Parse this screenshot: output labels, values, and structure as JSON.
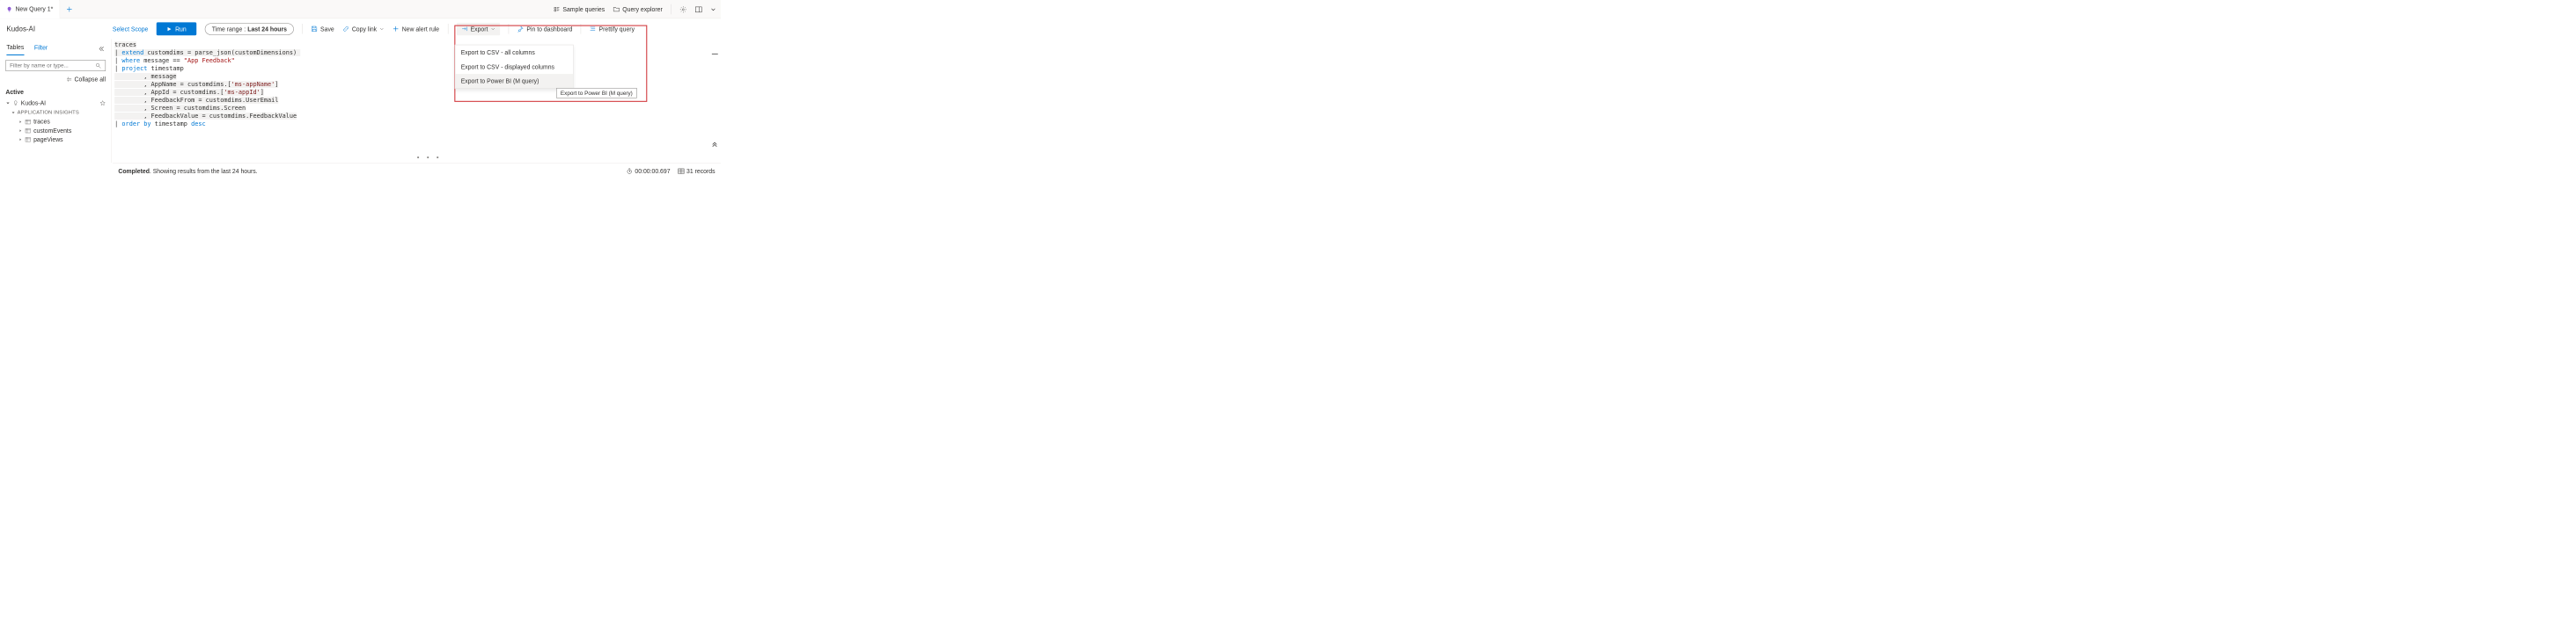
{
  "tabs": {
    "active": "New Query 1*"
  },
  "topRight": {
    "sample": "Sample queries",
    "explorer": "Query explorer"
  },
  "toolbar": {
    "scopeName": "Kudos-AI",
    "selectScope": "Select Scope",
    "run": "Run",
    "timeLabel": "Time range : ",
    "timeValue": "Last 24 hours",
    "save": "Save",
    "copy": "Copy link",
    "alert": "New alert rule",
    "export": "Export",
    "pin": "Pin to dashboard",
    "prettify": "Prettify query"
  },
  "exportMenu": {
    "csvAll": "Export to CSV - all columns",
    "csvDisp": "Export to CSV - displayed columns",
    "pbi": "Export to Power BI (M query)",
    "tooltip": "Export to Power BI (M query)"
  },
  "sidebar": {
    "tabTables": "Tables",
    "tabFilter": "Filter",
    "searchPlaceholder": "Filter by name or type...",
    "collapse": "Collapse all",
    "activeHdr": "Active",
    "root": "Kudos-AI",
    "group": "APPLICATION INSIGHTS",
    "leaves": [
      "traces",
      "customEvents",
      "pageViews"
    ]
  },
  "query": {
    "l1": "traces",
    "l2a": "| ",
    "l2b": "extend",
    "l2c": " customdims = parse_json(customDimensions)",
    "l3a": "| ",
    "l3b": "where",
    "l3c": " message == ",
    "l3d": "\"App Feedback\"",
    "l4a": "| ",
    "l4b": "project",
    "l4c": " timestamp",
    "l5": "        , message",
    "l6a": "        , AppName = customdims.[",
    "l6b": "'ms-appName'",
    "l6c": "]",
    "l7a": "        , AppId = customdims.[",
    "l7b": "'ms-appId'",
    "l7c": "]",
    "l8": "        , FeedbackFrom = customdims.UserEmail",
    "l9": "        , Screen = customdims.Screen",
    "l10": "        , FeedbackValue = customdims.FeedbackValue",
    "l11a": "| ",
    "l11b": "order by",
    "l11c": " timestamp ",
    "l11d": "desc"
  },
  "status": {
    "done": "Completed",
    "rest": ". Showing results from the last 24 hours.",
    "time": "00:00:00.697",
    "records": "31 records"
  }
}
